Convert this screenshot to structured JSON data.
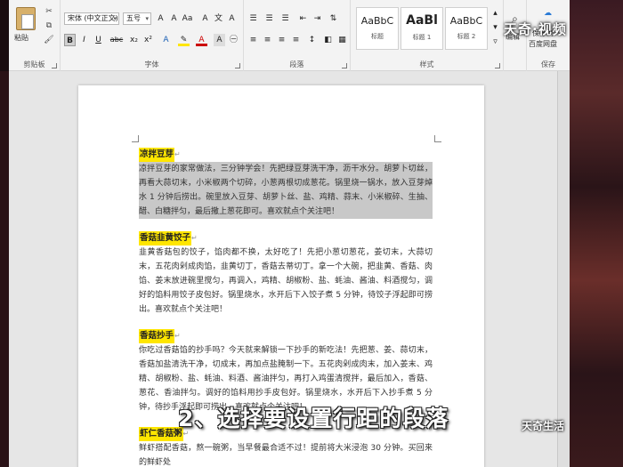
{
  "ribbon": {
    "clipboard": {
      "paste_label": "粘贴",
      "group_label": "剪贴板"
    },
    "font": {
      "font_name": "宋体 (中文正文)",
      "font_size": "五号",
      "bold": "B",
      "italic": "I",
      "underline": "U",
      "strike": "abc",
      "subscript": "x₂",
      "superscript": "x²",
      "group_label": "字体"
    },
    "paragraph": {
      "group_label": "段落"
    },
    "styles": {
      "items": [
        {
          "sample": "AaBbC",
          "name": "标题"
        },
        {
          "sample": "AaBl",
          "name": "标题 1"
        },
        {
          "sample": "AaBbC",
          "name": "标题 2"
        }
      ],
      "group_label": "样式"
    },
    "editing": {
      "label": "编辑"
    },
    "save": {
      "line1": "保存到",
      "line2": "百度网盘",
      "group_label": "保存"
    },
    "watermark_logo": "天奇·视频"
  },
  "document": {
    "sections": [
      {
        "heading": "凉拌豆芽",
        "text": "凉拌豆芽的家常做法，三分钟学会！先把绿豆芽洗干净，沥干水分。胡萝卜切丝，再看大蒜切末，小米椒两个切碎，小葱两根切成葱花。锅里烧一锅水，放入豆芽焯水 1 分钟后捞出。碗里放入豆芽、胡萝卜丝、盐、鸡精、蒜末、小米椒碎、生抽、醋、白糖拌匀，最后撒上葱花即可。喜欢就点个关注吧！",
        "selected": true
      },
      {
        "heading": "香菇韭黄饺子",
        "text": "韭黄香菇包的饺子，馅肉都不换，太好吃了！先把小葱切葱花，姜切末，大蒜切末，五花肉剁成肉馅，韭黄切丁，香菇去蒂切丁。拿一个大碗，把韭黄、香菇、肉馅、姜末放进碗里搅匀，再调入，鸡精、胡椒粉、盐、蚝油、酱油、料酒搅匀，调好的馅料用饺子皮包好。锅里烧水，水开后下入饺子煮 5 分钟，待饺子浮起即可捞出。喜欢就点个关注吧！",
        "selected": false
      },
      {
        "heading": "香菇抄手",
        "text": "你吃过香菇馅的抄手吗？今天就来解锁一下抄手的新吃法！先把葱、姜、蒜切末，香菇加盐清洗干净，切成末，再加点盐腌制一下。五花肉剁成肉末，加入姜末、鸡精、胡椒粉、盐、蚝油、料酒、酱油拌匀，再打入鸡蛋清搅拌，最后加入，香菇、葱花、香油拌匀。调好的馅料用抄手皮包好。锅里烧水，水开后下入抄手煮 5 分钟，待抄手浮起即可捞出。喜欢就点个关注吧！",
        "selected": false
      },
      {
        "heading": "虾仁香菇粥",
        "text": "鲜虾搭配香菇，熬一碗粥，当早餐最合适不过！提前将大米浸泡 30 分钟。买回来的鲜虾处",
        "selected": false
      }
    ]
  },
  "overlay": {
    "subtitle": "2、选择要设置行距的段落",
    "brand": "天奇生活"
  },
  "colors": {
    "highlight": "#ffe600",
    "selection": "#c8c8c8",
    "ribbon_bg": "#f3f3f3"
  }
}
